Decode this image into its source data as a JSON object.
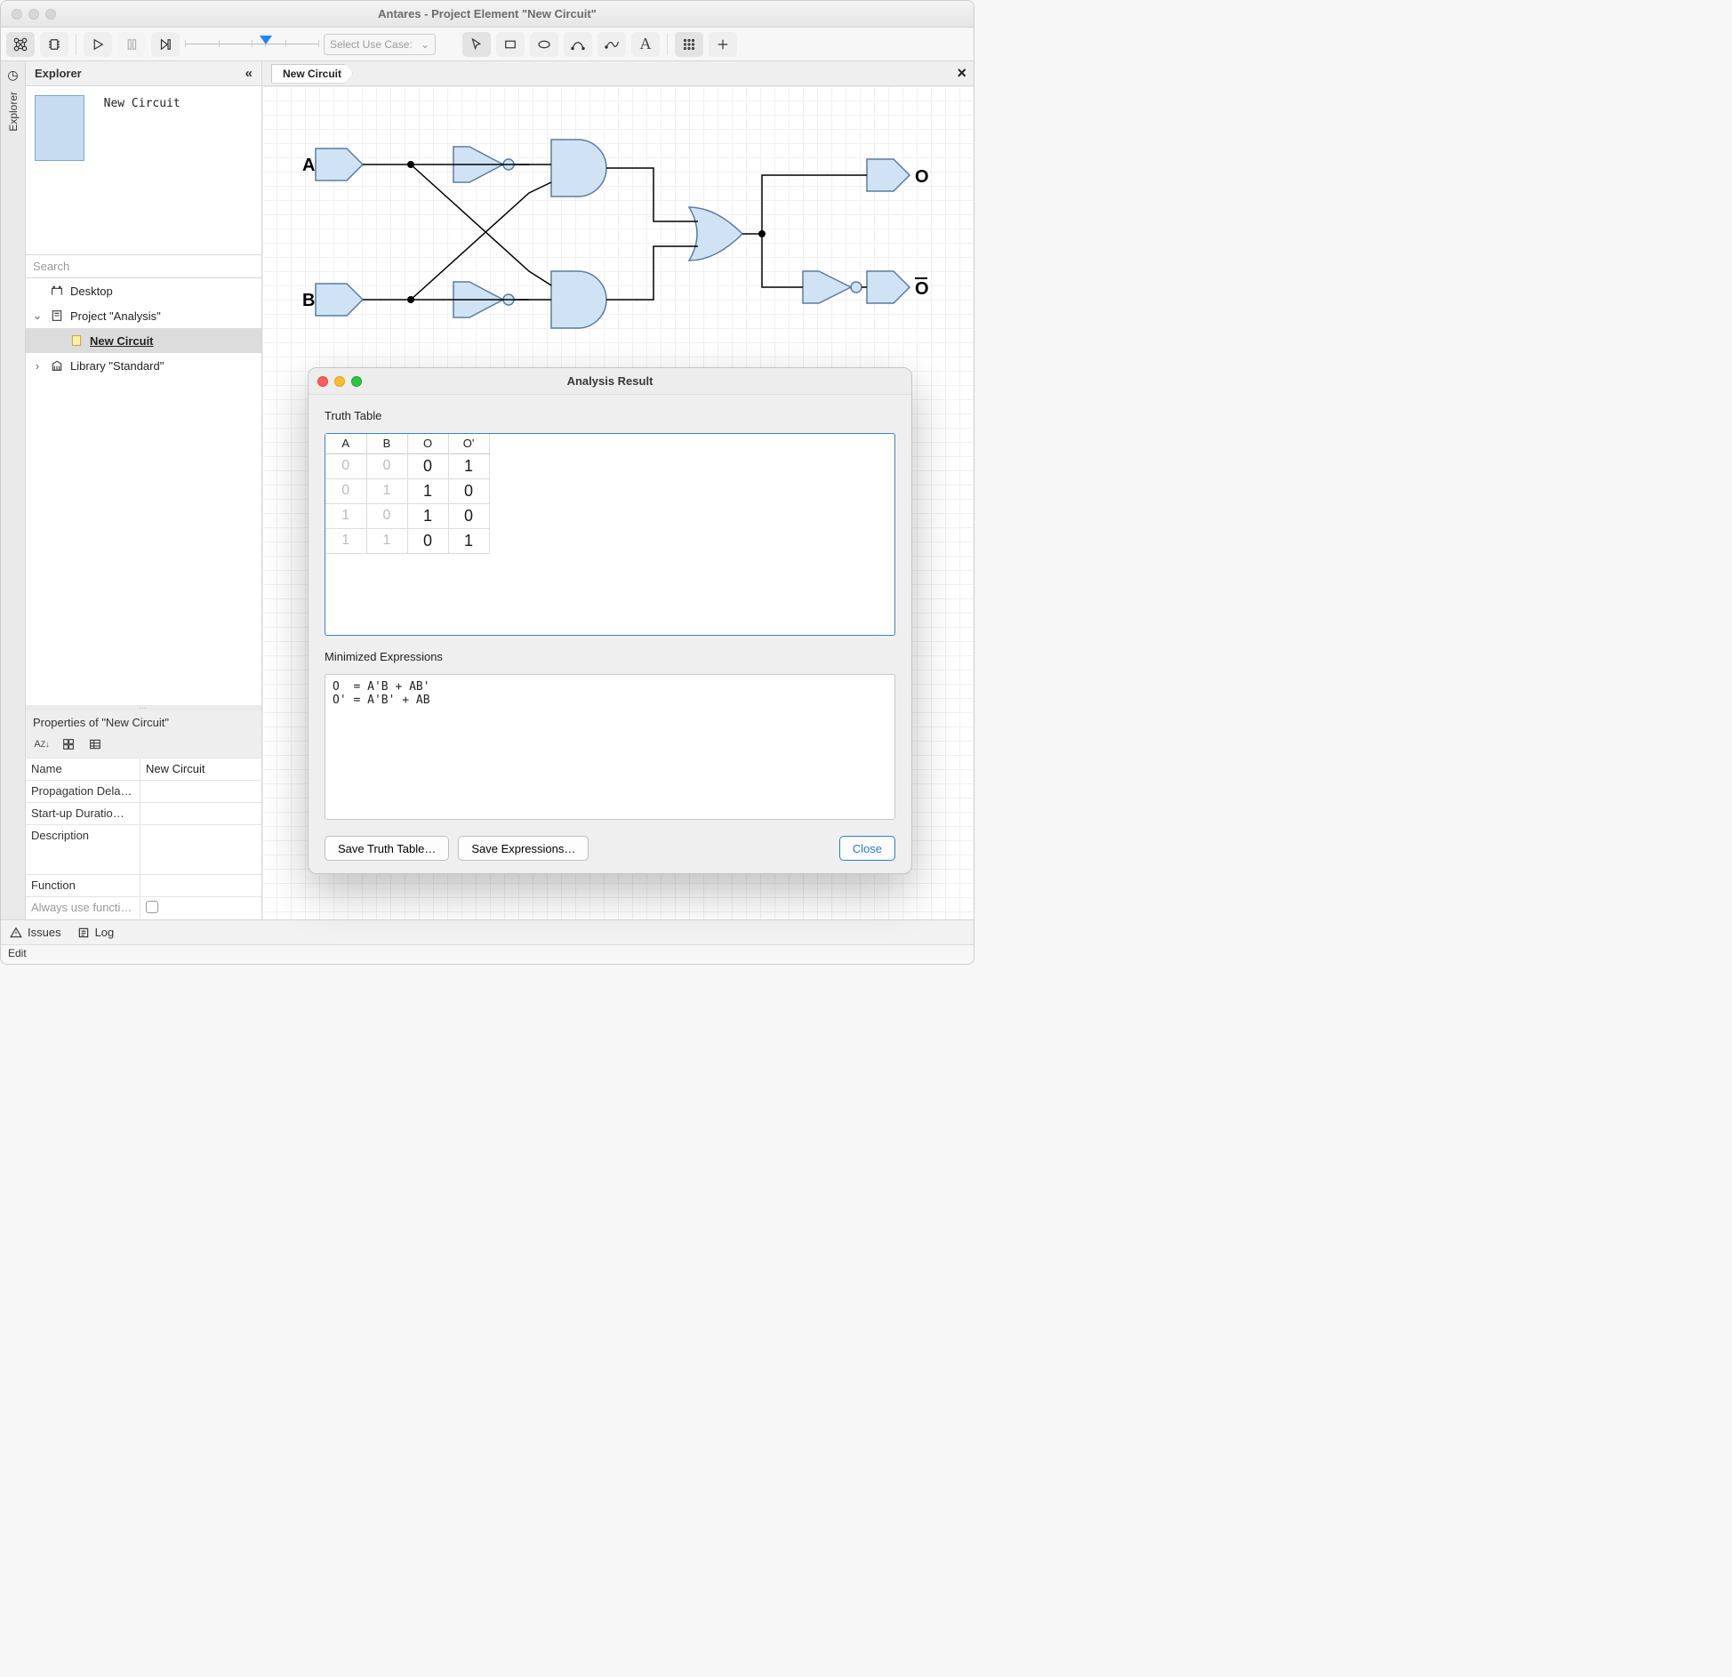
{
  "window": {
    "title": "Antares - Project Element \"New Circuit\""
  },
  "toolbar": {
    "use_case_placeholder": "Select Use Case:",
    "icons": [
      "graph",
      "chip",
      "play",
      "pause",
      "step",
      "pointer",
      "rect",
      "ellipse",
      "curve",
      "spline",
      "text",
      "grid",
      "plus"
    ]
  },
  "rail": {
    "label": "Explorer"
  },
  "explorer": {
    "title": "Explorer",
    "item_label": "New Circuit"
  },
  "search": {
    "placeholder": "Search"
  },
  "tree": {
    "desktop": "Desktop",
    "project": "Project \"Analysis\"",
    "circuit": "New Circuit",
    "library": "Library \"Standard\""
  },
  "tab": {
    "label": "New Circuit"
  },
  "circuit": {
    "inputs": {
      "A": "A",
      "B": "B"
    },
    "outputs": {
      "O": "O",
      "Obar_base": "O"
    }
  },
  "props": {
    "title": "Properties of \"New Circuit\"",
    "rows": {
      "name_label": "Name",
      "name_value": "New Circuit",
      "prop_delay": "Propagation Dela…",
      "startup": "Start-up Duratio…",
      "description": "Description",
      "function": "Function",
      "always": "Always use functi…"
    }
  },
  "dialog": {
    "title": "Analysis Result",
    "tt_label": "Truth Table",
    "columns": [
      "A",
      "B",
      "O",
      "O'"
    ],
    "rows": [
      [
        "0",
        "0",
        "0",
        "1"
      ],
      [
        "0",
        "1",
        "1",
        "0"
      ],
      [
        "1",
        "0",
        "1",
        "0"
      ],
      [
        "1",
        "1",
        "0",
        "1"
      ]
    ],
    "expr_label": "Minimized Expressions",
    "expr_text": "O  = A'B + AB'\nO' = A'B' + AB",
    "save_tt": "Save Truth Table…",
    "save_expr": "Save Expressions…",
    "close": "Close"
  },
  "status": {
    "issues": "Issues",
    "log": "Log"
  },
  "footer": {
    "mode": "Edit"
  }
}
